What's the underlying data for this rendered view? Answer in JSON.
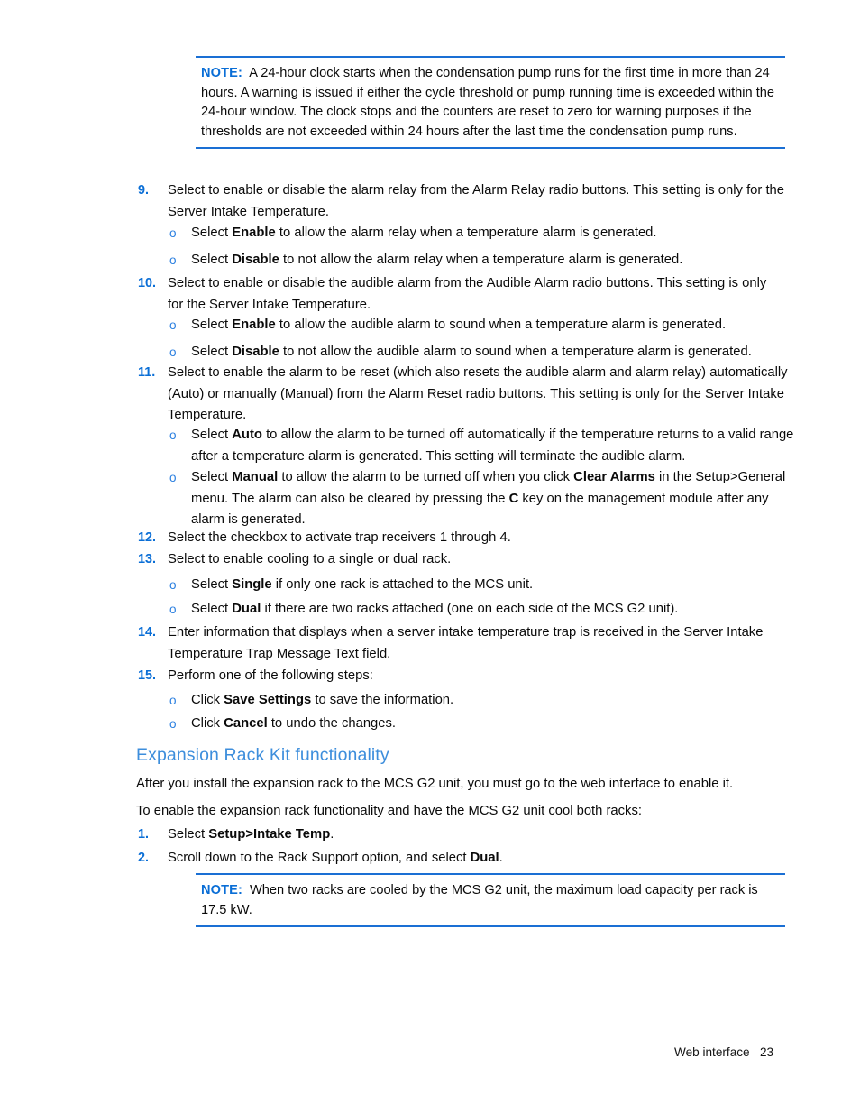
{
  "page": {
    "footer_text": "Web interface   23",
    "page_number": "23",
    "footer_label": "Web interface"
  },
  "colors": {
    "note_rule": "#1a6fd4",
    "note_label": "#0a6ed6",
    "step_number": "#0a6ed6",
    "sub_bullet": "#2a7fe0",
    "heading": "#3d8edc",
    "body_text": "#0a0a0a",
    "background": "#ffffff"
  },
  "notes": [
    {
      "label": "NOTE:",
      "text": "A 24-hour clock starts when the condensation pump runs for the first time in more than 24 hours. A warning is issued if either the cycle threshold or pump running time is exceeded within the 24-hour window. The clock stops and the counters are reset to zero for warning purposes if the thresholds are not exceeded within 24 hours after the last time the condensation pump runs."
    },
    {
      "label": "NOTE:",
      "text": "When two racks are cooled by the MCS G2 unit, the maximum load capacity per rack is 17.5 kW."
    }
  ],
  "steps": {
    "s9": {
      "num": "9.",
      "t1": "Select to enable or disable the alarm relay from the Alarm Relay radio buttons. This setting is only for the Server Intake Temperature."
    },
    "s9a": {
      "marker": "o",
      "pre": "Select ",
      "bold": "Enable",
      "post": " to allow the alarm relay when a temperature alarm is generated."
    },
    "s9b": {
      "marker": "o",
      "pre": "Select ",
      "bold": "Disable",
      "post": " to not allow the alarm relay when a temperature alarm is generated."
    },
    "s10": {
      "num": "10.",
      "t1": "Select to enable or disable the audible alarm from the Audible Alarm radio buttons. This setting is only for the Server Intake Temperature."
    },
    "s10a": {
      "marker": "o",
      "pre": "Select ",
      "bold": "Enable",
      "post": " to allow the audible alarm to sound when a temperature alarm is generated."
    },
    "s10b": {
      "marker": "o",
      "pre": "Select ",
      "bold": "Disable",
      "post": " to not allow the audible alarm to sound when a temperature alarm is generated."
    },
    "s11": {
      "num": "11.",
      "t1": "Select to enable the alarm to be reset (which also resets the audible alarm and alarm relay) automatically (Auto) or manually (Manual) from the Alarm Reset radio buttons. This setting is only for the Server Intake Temperature."
    },
    "s11a": {
      "marker": "o",
      "pre": "Select ",
      "bold": "Auto",
      "post": " to allow the alarm to be turned off automatically if the temperature returns to a valid range after a temperature alarm is generated. This setting will terminate the audible alarm."
    },
    "s11b": {
      "marker": "o",
      "p1": "Select ",
      "b1": "Manual",
      "p2": " to allow the alarm to be turned off when you click ",
      "b2": "Clear Alarms",
      "p3": " in the Setup>General menu. The alarm can also be cleared by pressing the ",
      "b3": "C",
      "p4": " key on the management module after any alarm is generated."
    },
    "s12": {
      "num": "12.",
      "t1": "Select the checkbox to activate trap receivers 1 through 4."
    },
    "s13": {
      "num": "13.",
      "t1": "Select to enable cooling to a single or dual rack."
    },
    "s13a": {
      "marker": "o",
      "pre": "Select ",
      "bold": "Single",
      "post": " if only one rack is attached to the MCS unit."
    },
    "s13b": {
      "marker": "o",
      "pre": "Select ",
      "bold": "Dual",
      "post": " if there are two racks attached (one on each side of the MCS G2 unit)."
    },
    "s14": {
      "num": "14.",
      "t1": "Enter information that displays when a server intake temperature trap is received in the Server Intake Temperature Trap Message Text field."
    },
    "s15": {
      "num": "15.",
      "t1": "Perform one of the following steps:"
    },
    "s15a": {
      "marker": "o",
      "pre": "Click ",
      "bold": "Save Settings",
      "post": " to save the information."
    },
    "s15b": {
      "marker": "o",
      "pre": "Click ",
      "bold": "Cancel",
      "post": " to undo the changes."
    }
  },
  "section": {
    "heading": "Expansion Rack Kit functionality",
    "para1": "After you install the expansion rack to the MCS G2 unit, you must go to the web interface to enable it.",
    "para2": "To enable the expansion rack functionality and have the MCS G2 unit cool both racks:",
    "step1": {
      "num": "1.",
      "pre": "Select ",
      "bold": "Setup>Intake Temp",
      "post": "."
    },
    "step2": {
      "num": "2.",
      "pre": "Scroll down to the Rack Support option, and select ",
      "bold": "Dual",
      "post": "."
    }
  }
}
